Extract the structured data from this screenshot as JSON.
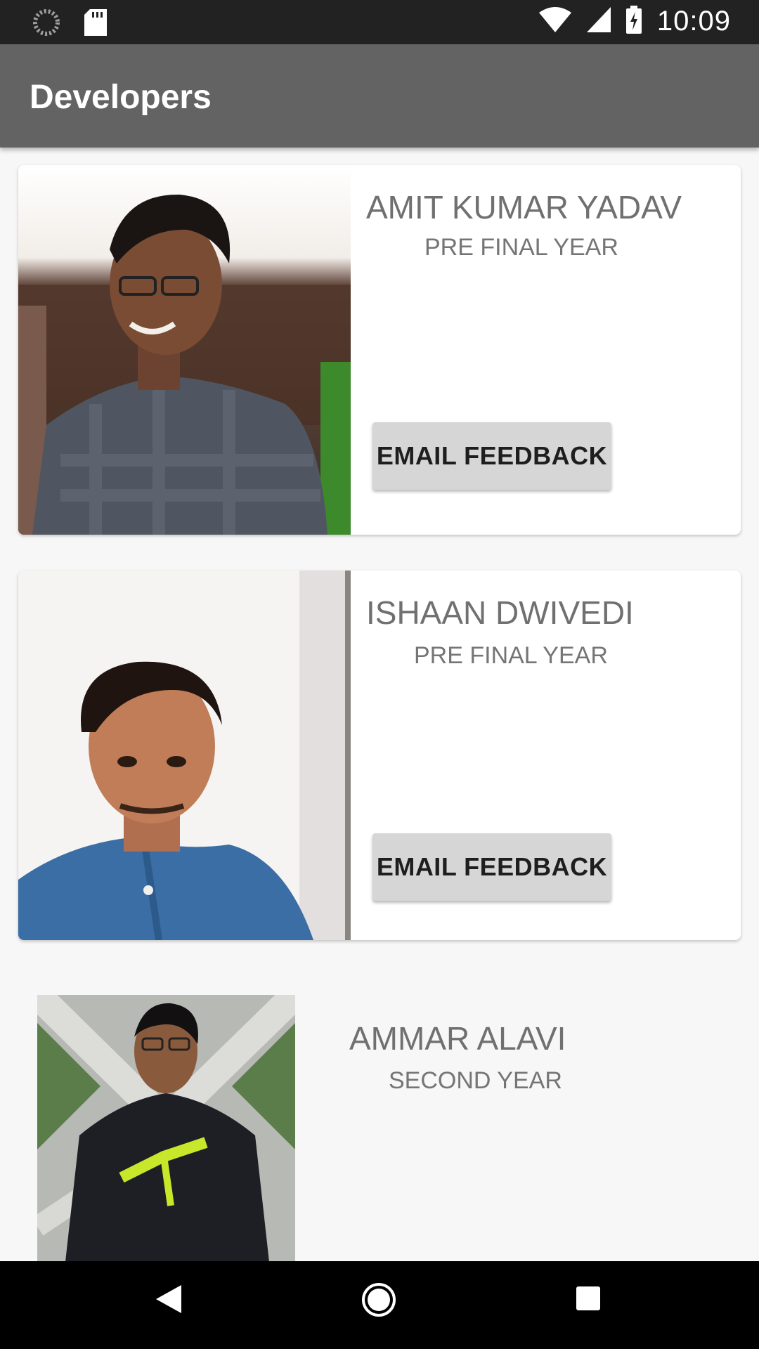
{
  "status_bar": {
    "time": "10:09",
    "icons": [
      "loading-icon",
      "sd-card-icon",
      "wifi-icon",
      "signal-icon",
      "battery-charging-icon"
    ]
  },
  "app_bar": {
    "title": "Developers"
  },
  "developers": [
    {
      "name": "AMIT KUMAR YADAV",
      "year": "PRE FINAL YEAR",
      "button": "EMAIL FEEDBACK"
    },
    {
      "name": "ISHAAN DWIVEDI",
      "year": "PRE FINAL YEAR",
      "button": "EMAIL FEEDBACK"
    },
    {
      "name": "AMMAR ALAVI",
      "year": "SECOND YEAR"
    }
  ],
  "nav_bar": {
    "icons": [
      "back-icon",
      "home-icon",
      "recents-icon"
    ]
  }
}
